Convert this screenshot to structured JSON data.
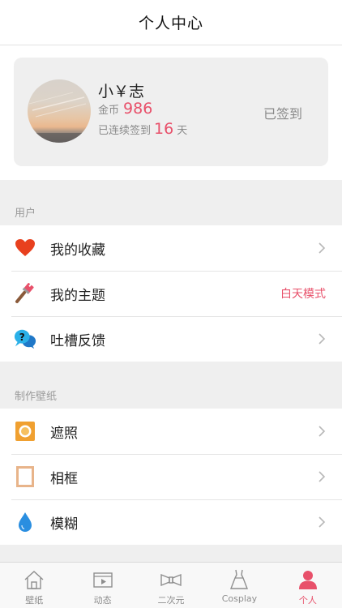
{
  "header": {
    "title": "个人中心"
  },
  "profile": {
    "username": "小￥志",
    "coins_label": "金币",
    "coins_value": "986",
    "streak_label": "已连续签到",
    "streak_value": "16",
    "streak_unit": "天",
    "checkin_label": "已签到"
  },
  "sections": {
    "user": {
      "title": "用户",
      "items": [
        {
          "label": "我的收藏",
          "icon": "heart-icon"
        },
        {
          "label": "我的主题",
          "icon": "paintbrush-icon",
          "value": "白天模式"
        },
        {
          "label": "吐槽反馈",
          "icon": "chat-question-icon"
        }
      ]
    },
    "wallpaper": {
      "title": "制作壁纸",
      "items": [
        {
          "label": "遮照",
          "icon": "mask-icon"
        },
        {
          "label": "相框",
          "icon": "frame-icon"
        },
        {
          "label": "模糊",
          "icon": "droplet-icon"
        }
      ]
    }
  },
  "tabbar": {
    "active": "个人",
    "items": [
      {
        "label": "壁纸",
        "icon": "home-icon"
      },
      {
        "label": "动态",
        "icon": "video-icon"
      },
      {
        "label": "二次元",
        "icon": "bow-icon"
      },
      {
        "label": "Cosplay",
        "icon": "dress-icon"
      },
      {
        "label": "个人",
        "icon": "person-icon"
      }
    ]
  },
  "colors": {
    "accent": "#e8506a",
    "background": "#efefef",
    "card": "#efefef",
    "heart": "#e8401e",
    "mask": "#f0a030",
    "frame": "#e8b48a",
    "droplet": "#2a8ee0",
    "chat": "#2ab0e8"
  }
}
